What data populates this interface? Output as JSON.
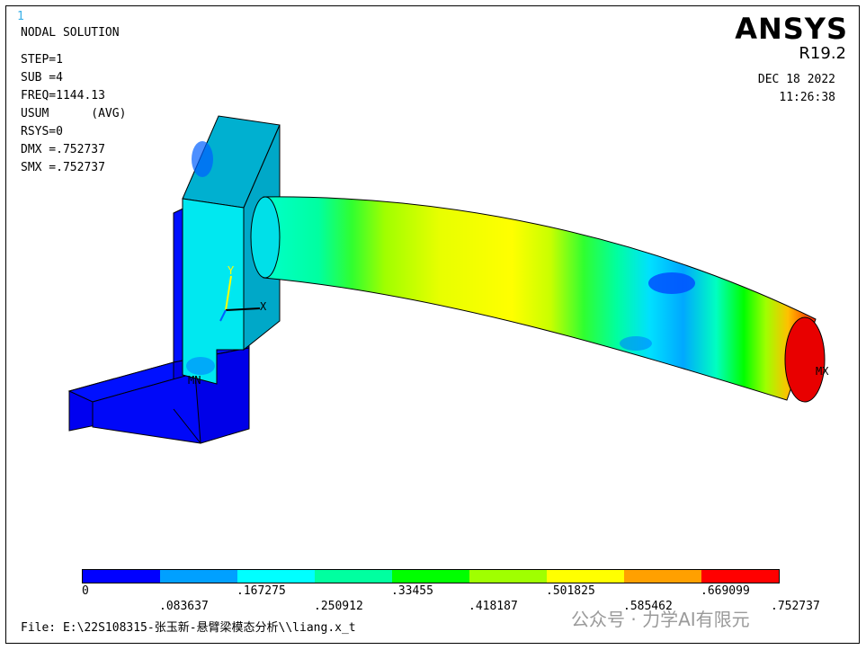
{
  "window_number": "1",
  "header": {
    "title": "NODAL SOLUTION",
    "lines": [
      "STEP=1",
      "SUB =4",
      "FREQ=1144.13",
      "USUM      (AVG)",
      "RSYS=0",
      "DMX =.752737",
      "SMX =.752737"
    ]
  },
  "brand": {
    "name": "ANSYS",
    "release": "R19.2"
  },
  "date": "DEC 18 2022",
  "time": "11:26:38",
  "labels": {
    "mn": "MN",
    "mx": "MX",
    "axis_y": "Y",
    "axis_x": "X"
  },
  "legend": {
    "colors": [
      "#0000ff",
      "#00a0ff",
      "#00ffff",
      "#00ffa0",
      "#00ff00",
      "#a0ff00",
      "#ffff00",
      "#ffa000",
      "#ff0000"
    ],
    "values": [
      "0",
      ".083637",
      ".167275",
      ".250912",
      ".33455",
      ".418187",
      ".501825",
      ".585462",
      ".669099",
      ".752737"
    ]
  },
  "file_line": "File: E:\\22S108315-张玉新-悬臂梁模态分析\\\\liang.x_t",
  "watermark": "公众号 · 力学AI有限元"
}
